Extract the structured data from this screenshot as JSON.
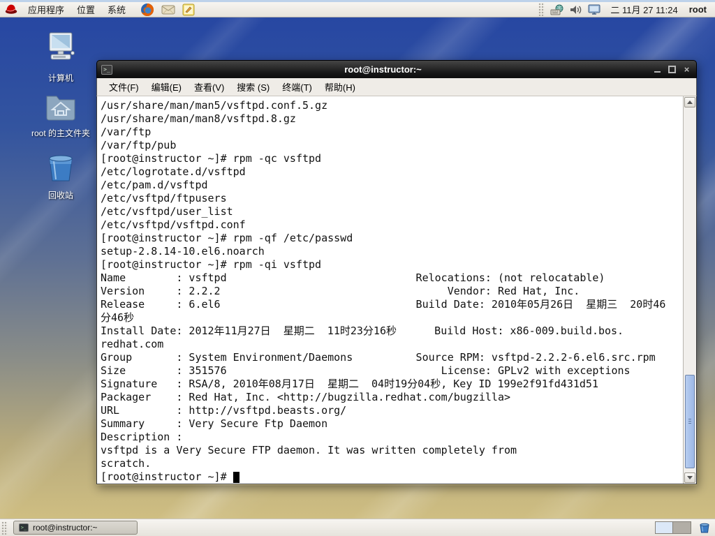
{
  "top_panel": {
    "menus": [
      "应用程序",
      "位置",
      "系统"
    ],
    "launcher_icons": [
      "firefox",
      "email",
      "notes"
    ],
    "status_icons": [
      "input-method",
      "volume",
      "display"
    ],
    "clock": "二 11月 27 11:24",
    "user_label": "root"
  },
  "desktop_icons": [
    {
      "icon": "computer",
      "label": "计算机"
    },
    {
      "icon": "home-folder",
      "label": "root 的主文件夹"
    },
    {
      "icon": "trash",
      "label": "回收站"
    }
  ],
  "terminal_window": {
    "title": "root@instructor:~",
    "title_icon_glyph": ">_",
    "menu_items": [
      "文件(F)",
      "编辑(E)",
      "查看(V)",
      "搜索 (S)",
      "终端(T)",
      "帮助(H)"
    ],
    "output_lines": [
      "/usr/share/man/man5/vsftpd.conf.5.gz",
      "/usr/share/man/man8/vsftpd.8.gz",
      "/var/ftp",
      "/var/ftp/pub",
      "[root@instructor ~]# rpm -qc vsftpd",
      "/etc/logrotate.d/vsftpd",
      "/etc/pam.d/vsftpd",
      "/etc/vsftpd/ftpusers",
      "/etc/vsftpd/user_list",
      "/etc/vsftpd/vsftpd.conf",
      "[root@instructor ~]# rpm -qf /etc/passwd",
      "setup-2.8.14-10.el6.noarch",
      "[root@instructor ~]# rpm -qi vsftpd",
      "Name        : vsftpd                              Relocations: (not relocatable)",
      "Version     : 2.2.2                                    Vendor: Red Hat, Inc.",
      "Release     : 6.el6                               Build Date: 2010年05月26日  星期三  20时46",
      "分46秒",
      "Install Date: 2012年11月27日  星期二  11时23分16秒      Build Host: x86-009.build.bos.",
      "redhat.com",
      "Group       : System Environment/Daemons          Source RPM: vsftpd-2.2.2-6.el6.src.rpm",
      "Size        : 351576                                  License: GPLv2 with exceptions",
      "Signature   : RSA/8, 2010年08月17日  星期二  04时19分04秒, Key ID 199e2f91fd431d51",
      "Packager    : Red Hat, Inc. <http://bugzilla.redhat.com/bugzilla>",
      "URL         : http://vsftpd.beasts.org/",
      "Summary     : Very Secure Ftp Daemon",
      "Description :",
      "vsftpd is a Very Secure FTP daemon. It was written completely from",
      "scratch."
    ],
    "prompt": "[root@instructor ~]# "
  },
  "taskbar": {
    "task_button_label": "root@instructor:~",
    "task_icon_glyph": ">_",
    "workspace_count": 2,
    "active_workspace": 1
  },
  "colors": {
    "wallpaper_top": "#2747a2",
    "wallpaper_bottom": "#cfbe82",
    "panel_bg": "#ece9e3",
    "titlebar_bg": "#1a1a1a",
    "terminal_bg": "#ffffff",
    "terminal_fg": "#111111",
    "scroll_thumb": "#9db8e6"
  }
}
